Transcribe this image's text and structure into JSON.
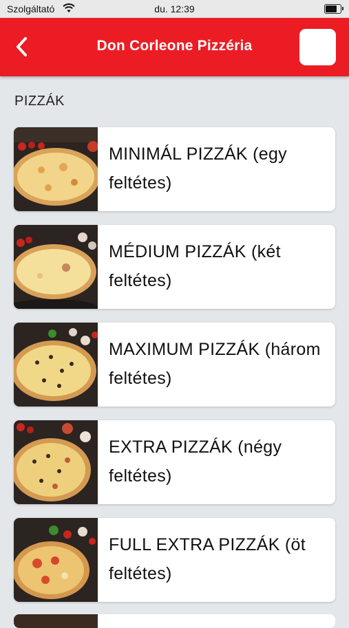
{
  "status": {
    "carrier": "Szolgáltató",
    "time": "du. 12:39"
  },
  "header": {
    "title": "Don Corleone Pizzéria"
  },
  "section": {
    "title": "PIZZÁK"
  },
  "categories": [
    {
      "label": "MINIMÁL PIZZÁK (egy feltétes)",
      "image": "pizza-photo"
    },
    {
      "label": "MÉDIUM PIZZÁK (két feltétes)",
      "image": "pizza-photo"
    },
    {
      "label": "MAXIMUM PIZZÁK (három feltétes)",
      "image": "pizza-photo"
    },
    {
      "label": "EXTRA PIZZÁK (négy feltétes)",
      "image": "pizza-photo"
    },
    {
      "label": "FULL EXTRA PIZZÁK (öt feltétes)",
      "image": "pizza-photo"
    }
  ],
  "colors": {
    "brand": "#ec1c24",
    "background": "#e4e7ea"
  }
}
